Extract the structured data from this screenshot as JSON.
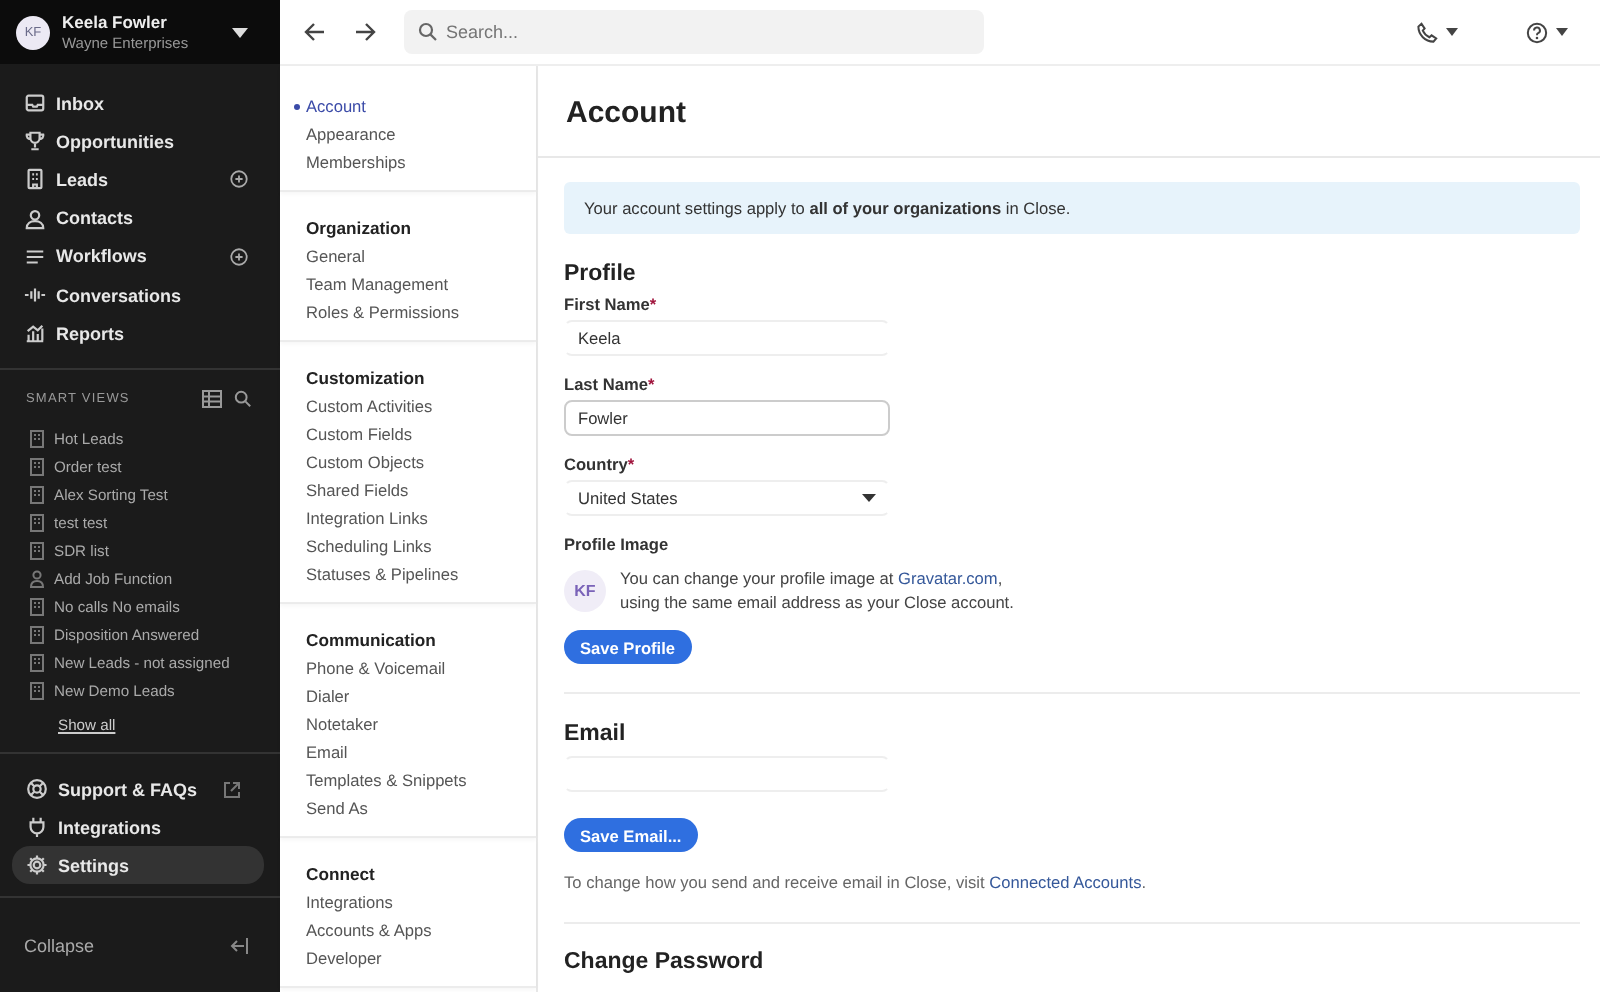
{
  "user": {
    "initials": "KF",
    "name": "Keela Fowler",
    "org": "Wayne Enterprises"
  },
  "nav": [
    {
      "label": "Inbox",
      "add_button": false
    },
    {
      "label": "Opportunities",
      "add_button": false
    },
    {
      "label": "Leads",
      "add_button": true
    },
    {
      "label": "Contacts",
      "add_button": false
    },
    {
      "label": "Workflows",
      "add_button": true
    },
    {
      "label": "Conversations",
      "add_button": false
    },
    {
      "label": "Reports",
      "add_button": false
    }
  ],
  "smart_views": {
    "title": "SMART VIEWS",
    "items": [
      {
        "label": "Hot Leads",
        "kind": "lead"
      },
      {
        "label": "Order test",
        "kind": "lead"
      },
      {
        "label": "Alex Sorting Test",
        "kind": "lead"
      },
      {
        "label": "test test",
        "kind": "lead"
      },
      {
        "label": "SDR list",
        "kind": "lead"
      },
      {
        "label": "Add Job Function",
        "kind": "contact"
      },
      {
        "label": "No calls No emails",
        "kind": "lead"
      },
      {
        "label": "Disposition Answered",
        "kind": "lead"
      },
      {
        "label": "New Leads - not assigned",
        "kind": "lead"
      },
      {
        "label": "New Demo Leads",
        "kind": "lead"
      }
    ],
    "show_all": "Show all"
  },
  "bottom_nav": [
    {
      "label": "Support & FAQs",
      "external": true,
      "selected": false
    },
    {
      "label": "Integrations",
      "external": false,
      "selected": false
    },
    {
      "label": "Settings",
      "external": false,
      "selected": true
    }
  ],
  "collapse": "Collapse",
  "search": {
    "placeholder": "Search..."
  },
  "settings_nav": [
    {
      "items": [
        {
          "label": "Account",
          "selected": true
        },
        {
          "label": "Appearance",
          "selected": false
        },
        {
          "label": "Memberships",
          "selected": false
        }
      ]
    },
    {
      "heading": "Organization",
      "items": [
        {
          "label": "General",
          "selected": false
        },
        {
          "label": "Team Management",
          "selected": false
        },
        {
          "label": "Roles & Permissions",
          "selected": false
        }
      ]
    },
    {
      "heading": "Customization",
      "items": [
        {
          "label": "Custom Activities",
          "selected": false
        },
        {
          "label": "Custom Fields",
          "selected": false
        },
        {
          "label": "Custom Objects",
          "selected": false
        },
        {
          "label": "Shared Fields",
          "selected": false
        },
        {
          "label": "Integration Links",
          "selected": false
        },
        {
          "label": "Scheduling Links",
          "selected": false
        },
        {
          "label": "Statuses & Pipelines",
          "selected": false
        }
      ]
    },
    {
      "heading": "Communication",
      "items": [
        {
          "label": "Phone & Voicemail",
          "selected": false
        },
        {
          "label": "Dialer",
          "selected": false
        },
        {
          "label": "Notetaker",
          "selected": false
        },
        {
          "label": "Email",
          "selected": false
        },
        {
          "label": "Templates & Snippets",
          "selected": false
        },
        {
          "label": "Send As",
          "selected": false
        }
      ]
    },
    {
      "heading": "Connect",
      "items": [
        {
          "label": "Integrations",
          "selected": false
        },
        {
          "label": "Accounts & Apps",
          "selected": false
        },
        {
          "label": "Developer",
          "selected": false
        }
      ]
    }
  ],
  "page_title": "Account",
  "notice": "Your account settings apply to **all of your organizations** in Close.",
  "profile": {
    "heading": "Profile",
    "fields": [
      {
        "label": "First Name",
        "required": "*",
        "value": "Keela",
        "kind": "text",
        "focused": false
      },
      {
        "label": "Last Name",
        "required": "*",
        "value": "Fowler",
        "kind": "text",
        "focused": true
      },
      {
        "label": "Country",
        "required": "*",
        "value": "United States",
        "kind": "select",
        "focused": false
      }
    ],
    "image_label": "Profile Image",
    "avatar": "KF",
    "image_hint": {
      "before": "You can change your profile image at ",
      "link": "Gravatar.com",
      "after": ",\nusing the same email address as your Close account."
    },
    "save": "Save Profile"
  },
  "email": {
    "heading": "Email",
    "save": "Save Email...",
    "hint": {
      "before": "To change how you send and receive email in Close, visit ",
      "link": "Connected Accounts",
      "after": "."
    }
  },
  "next_heading": "Change Password"
}
